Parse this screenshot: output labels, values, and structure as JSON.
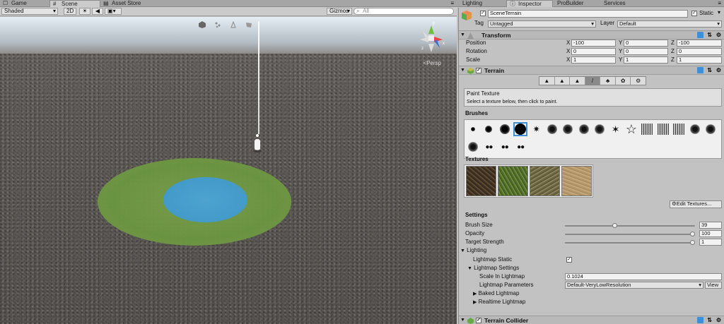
{
  "left_tabs": [
    {
      "label": "Game",
      "icon": "gamepad-icon"
    },
    {
      "label": "Scene",
      "icon": "grid-icon"
    },
    {
      "label": "Asset Store",
      "icon": "cart-icon"
    }
  ],
  "scene_toolbar": {
    "shading": "Shaded",
    "mode_2d": "2D",
    "gizmos": "Gizmos",
    "search_placeholder": "All"
  },
  "viewport": {
    "persp_label": "<Persp"
  },
  "right_tabs": [
    {
      "label": "Lighting"
    },
    {
      "label": "Inspector",
      "icon": "info-icon"
    },
    {
      "label": "ProBuilder"
    },
    {
      "label": "Services"
    }
  ],
  "inspector": {
    "object_name": "SceneTerrain",
    "static_label": "Static",
    "tag_label": "Tag",
    "tag_value": "Untagged",
    "layer_label": "Layer",
    "layer_value": "Default",
    "transform": {
      "title": "Transform",
      "rows": [
        {
          "label": "Position",
          "x": "-100",
          "y": "0",
          "z": "-100"
        },
        {
          "label": "Rotation",
          "x": "0",
          "y": "0",
          "z": "0"
        },
        {
          "label": "Scale",
          "x": "1",
          "y": "1",
          "z": "1"
        }
      ],
      "axis_x": "X",
      "axis_y": "Y",
      "axis_z": "Z"
    },
    "terrain": {
      "title": "Terrain",
      "tool_title": "Paint Texture",
      "tool_hint": "Select a texture below, then click to paint.",
      "brushes_label": "Brushes",
      "textures_label": "Textures",
      "edit_textures": "Edit Textures...",
      "settings_label": "Settings",
      "brush_size_label": "Brush Size",
      "brush_size": "39",
      "brush_size_fraction": 0.39,
      "opacity_label": "Opacity",
      "opacity": "100",
      "opacity_fraction": 1.0,
      "target_strength_label": "Target Strength",
      "target_strength": "1",
      "target_strength_fraction": 1.0,
      "lighting_label": "Lighting",
      "lightmap_static_label": "Lightmap Static",
      "lightmap_settings_label": "Lightmap Settings",
      "scale_in_lightmap_label": "Scale In Lightmap",
      "scale_in_lightmap": "0.1024",
      "lightmap_params_label": "Lightmap Parameters",
      "lightmap_params": "Default-VeryLowResolution",
      "view_button": "View",
      "baked_lightmap_label": "Baked Lightmap",
      "realtime_lightmap_label": "Realtime Lightmap"
    },
    "terrain_collider": {
      "title": "Terrain Collider"
    }
  },
  "colors": {
    "accent_blue": "#3f8fd6",
    "water": "#3e97c6",
    "grass": "#6b9640"
  }
}
